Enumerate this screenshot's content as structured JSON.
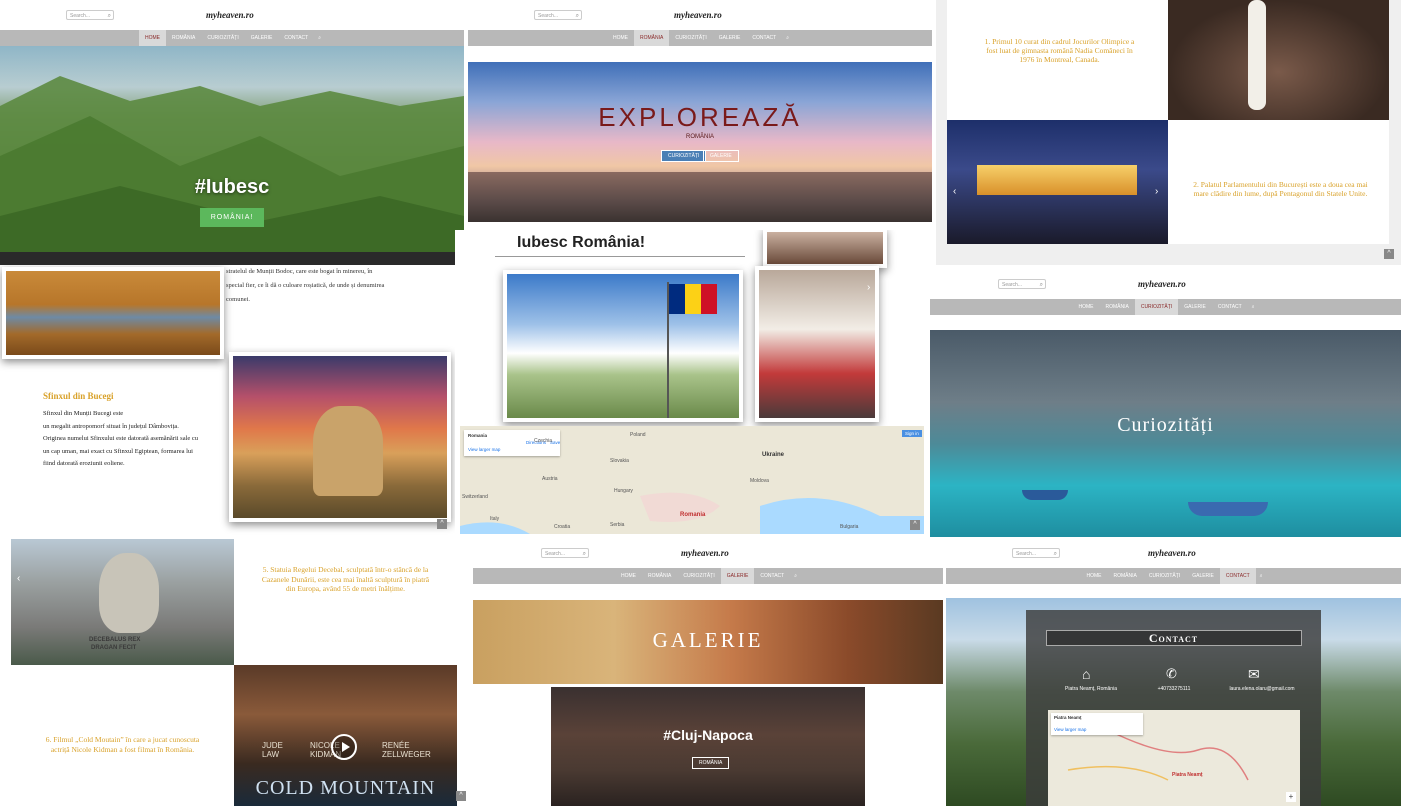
{
  "site": {
    "logo": "myheaven.ro",
    "search_placeholder": "Search...",
    "nav": [
      "HOME",
      "ROMÂNIA",
      "CURIOZITĂȚI",
      "GALERIE",
      "CONTACT"
    ]
  },
  "panel_home": {
    "title": "#Iubesc",
    "button": "ROMÂNIA!"
  },
  "panel_romania": {
    "title": "EXPLOREAZĂ",
    "subtitle": "ROMÂNIA",
    "btn1": "CURIOZITĂȚI",
    "btn2": "GALERIE"
  },
  "panel_facts1": {
    "fact1": "1. Primul 10 curat din cadrul Jocurilor Olimpice a fost luat de gimnasta română Nadia Comăneci în 1976 în Montreal, Canada.",
    "fact2": "2. Palatul Parlamentului din București este a doua cea mai mare clădire din lume, după Pentagonul din Statele Unite."
  },
  "panel_sfinx": {
    "top_text_1": "stratelul de Munții Bodoc, care este bogat în minereu, în",
    "top_text_2": "special fier, ce îi dă o culoare roșiatică, de unde și denumirea",
    "top_text_3": "comunei.",
    "heading": "Sfinxul din Bucegi",
    "body_1": "Sfinxul din Munții Bucegi este",
    "body_2": "un megalit antropomorf situat în județul Dâmbovița.",
    "body_3": "Originea numelui Sfinxului este datorată asemănării sale cu",
    "body_4": "un cap uman, mai exact cu Sfinxul Egiptean, formarea lui",
    "body_5": "fiind datorată eroziunii eoliene."
  },
  "panel_iubesc": {
    "heading": "Iubesc România!",
    "map": {
      "label": "Romania",
      "directions": "Directions",
      "save": "Save",
      "view_larger": "View larger map",
      "sign_in": "Sign in",
      "countries": [
        "Czechia",
        "Poland",
        "Slovakia",
        "Austria",
        "Hungary",
        "Ukraine",
        "Moldova",
        "Romania",
        "Croatia",
        "Switzerland",
        "Italy",
        "Serbia",
        "Bulgaria"
      ]
    }
  },
  "panel_curiozitati": {
    "title": "Curiozități"
  },
  "panel_facts2": {
    "fact5": "5. Statuia Regelui Decebal, sculptată într-o stâncă de la Cazanele Dunării, este cea mai înaltă sculptură în piatră din Europa, având 55 de metri înălțime.",
    "fact6": "6. Filmul „Cold Moutain” în care a jucat cunoscuta actriță Nicole Kidman a fost filmat în România.",
    "statue_inscription_1": "DECEBALUS REX",
    "statue_inscription_2": "DRAGAN FECIT",
    "poster_actors": [
      "JUDE LAW",
      "NICOLE KIDMAN",
      "RENÉE ZELLWEGER"
    ],
    "poster_title": "COLD MOUNTAIN"
  },
  "panel_galerie": {
    "title": "GALERIE",
    "city": "#Cluj-Napoca",
    "button": "ROMÂNIA"
  },
  "panel_contact": {
    "title": "Contact",
    "address": "Piatra Neamț, România",
    "phone": "+40733275111",
    "email": "laura.elena.olaru@gmail.com",
    "map_label": "Piatra Neamț",
    "map_city": "Piatra Neamț",
    "view_larger": "View larger map"
  },
  "colors": {
    "accent_yellow": "#d9a22b",
    "nav_gray": "#b8b8b8",
    "nav_active": "#8a2a2a",
    "green_button": "#5cb85c"
  }
}
